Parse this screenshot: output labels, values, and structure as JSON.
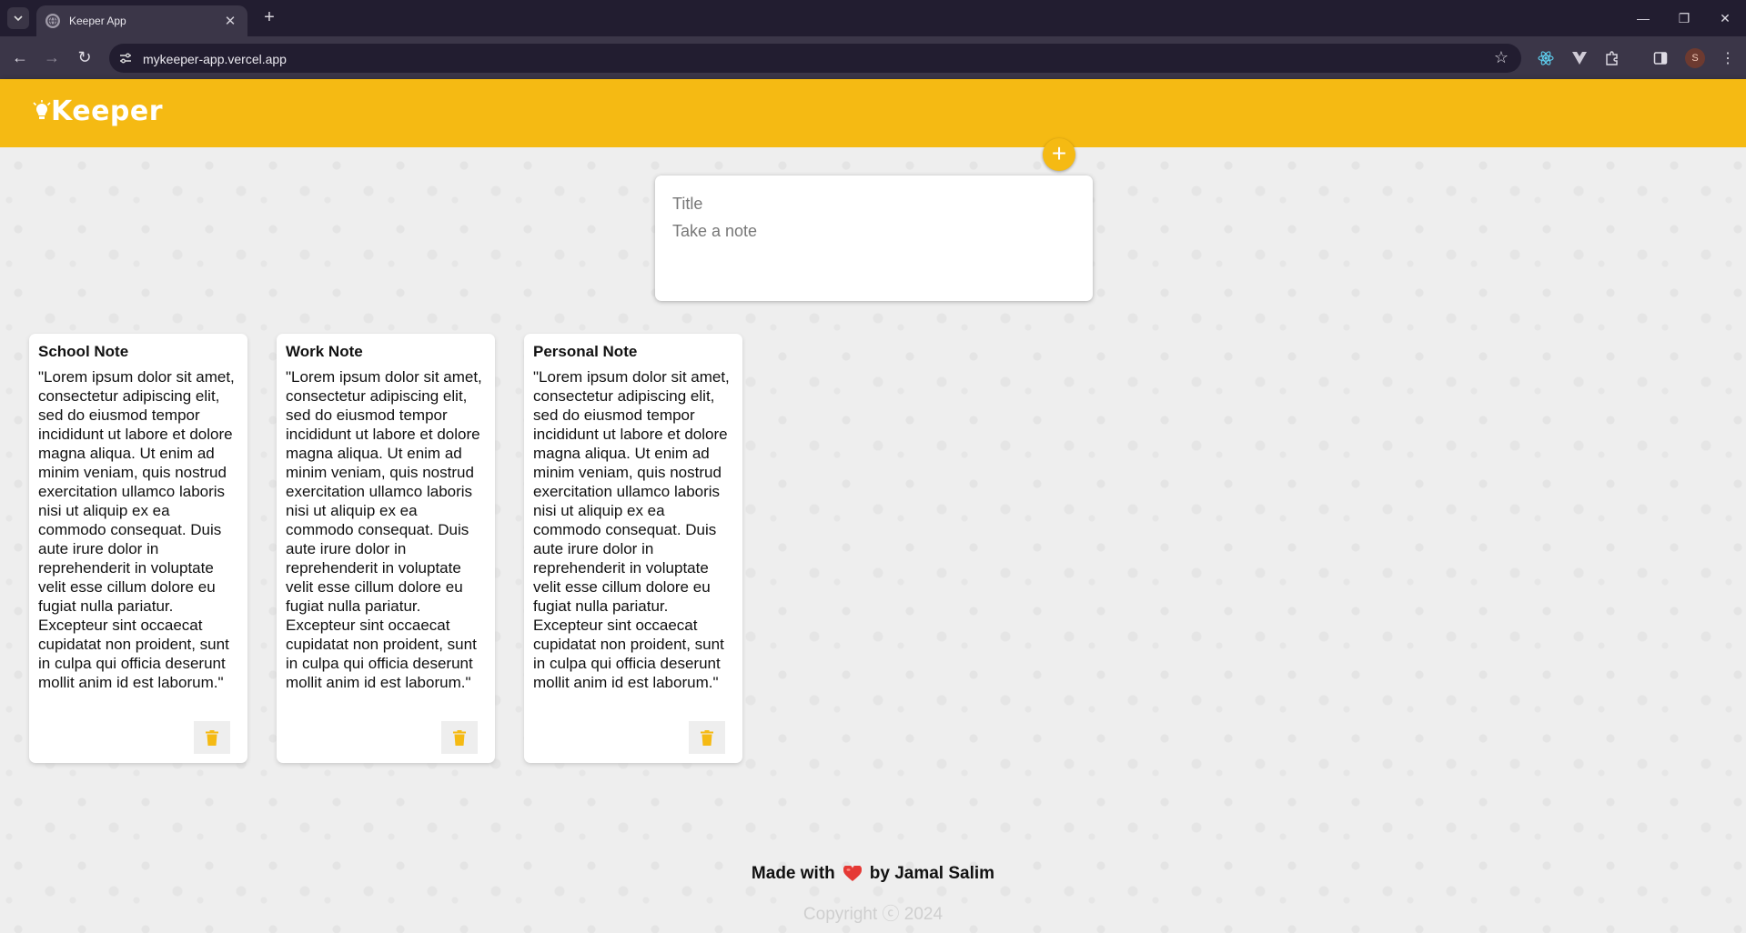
{
  "browser": {
    "tab_title": "Keeper App",
    "url": "mykeeper-app.vercel.app",
    "profile_initial": "S"
  },
  "app": {
    "logo_text": "Keeper",
    "brand_color": "#f5ba13"
  },
  "create_form": {
    "title_placeholder": "Title",
    "content_placeholder": "Take a note",
    "add_label": "+"
  },
  "notes": [
    {
      "title": "School Note",
      "content": "\"Lorem ipsum dolor sit amet, consectetur adipiscing elit, sed do eiusmod tempor incididunt ut labore et dolore magna aliqua. Ut enim ad minim veniam, quis nostrud exercitation ullamco laboris nisi ut aliquip ex ea commodo consequat. Duis aute irure dolor in reprehenderit in voluptate velit esse cillum dolore eu fugiat nulla pariatur. Excepteur sint occaecat cupidatat non proident, sunt in culpa qui officia deserunt mollit anim id est laborum.\""
    },
    {
      "title": "Work Note",
      "content": "\"Lorem ipsum dolor sit amet, consectetur adipiscing elit, sed do eiusmod tempor incididunt ut labore et dolore magna aliqua. Ut enim ad minim veniam, quis nostrud exercitation ullamco laboris nisi ut aliquip ex ea commodo consequat. Duis aute irure dolor in reprehenderit in voluptate velit esse cillum dolore eu fugiat nulla pariatur. Excepteur sint occaecat cupidatat non proident, sunt in culpa qui officia deserunt mollit anim id est laborum.\""
    },
    {
      "title": "Personal Note",
      "content": "\"Lorem ipsum dolor sit amet, consectetur adipiscing elit, sed do eiusmod tempor incididunt ut labore et dolore magna aliqua. Ut enim ad minim veniam, quis nostrud exercitation ullamco laboris nisi ut aliquip ex ea commodo consequat. Duis aute irure dolor in reprehenderit in voluptate velit esse cillum dolore eu fugiat nulla pariatur. Excepteur sint occaecat cupidatat non proident, sunt in culpa qui officia deserunt mollit anim id est laborum.\""
    }
  ],
  "footer": {
    "made_with": "Made with",
    "by": "by Jamal Salim",
    "copyright": "Copyright ⓒ 2024"
  },
  "icons": {
    "delete": "trash-icon",
    "heart": "heart-icon",
    "logo": "lightbulb-icon"
  }
}
